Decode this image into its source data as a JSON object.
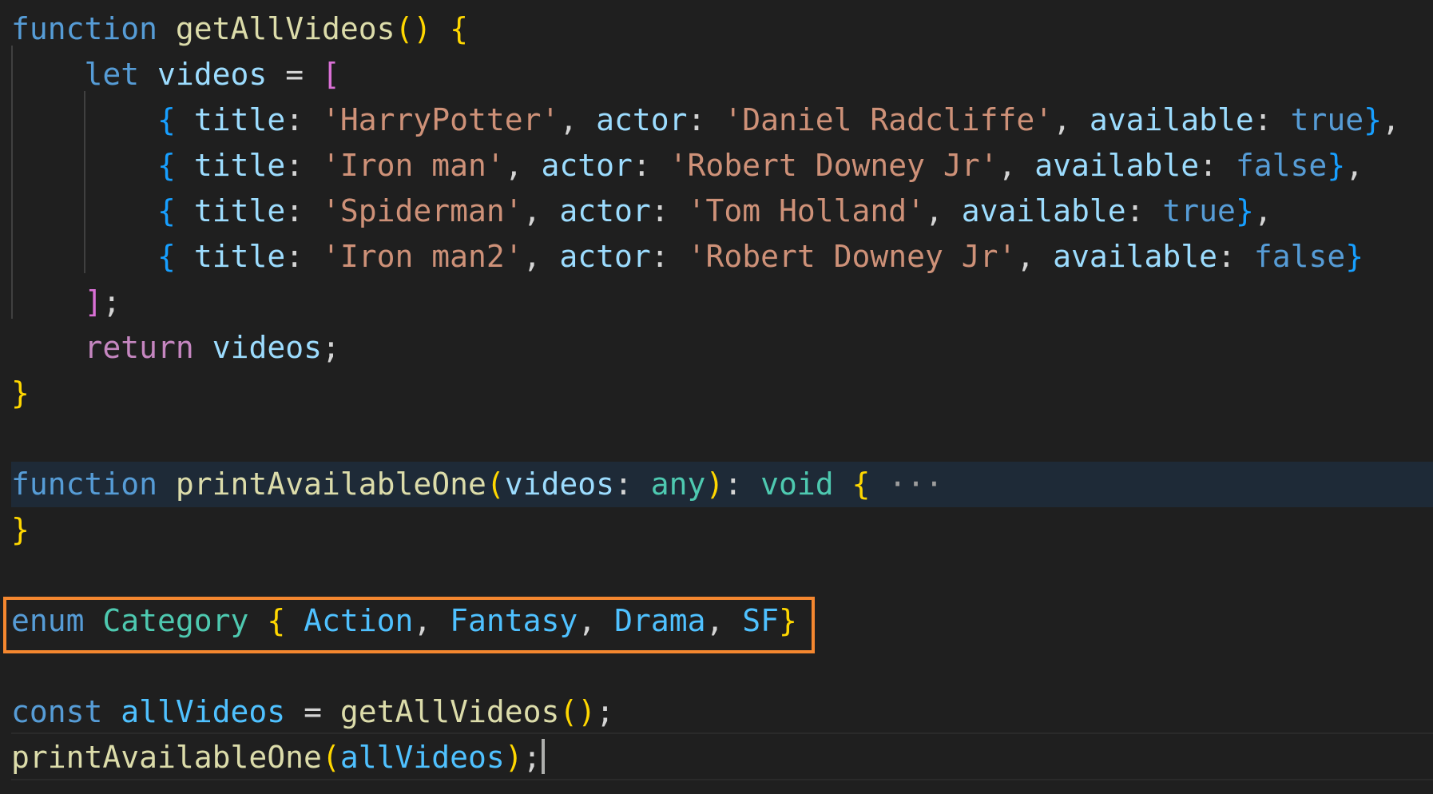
{
  "editor": {
    "lines": [
      [
        {
          "t": "function",
          "c": "kw"
        },
        {
          "t": " ",
          "c": "p"
        },
        {
          "t": "getAllVideos",
          "c": "fn"
        },
        {
          "t": "()",
          "c": "b1"
        },
        {
          "t": " ",
          "c": "p"
        },
        {
          "t": "{",
          "c": "b1"
        }
      ],
      [
        {
          "t": "    ",
          "c": "p"
        },
        {
          "t": "let",
          "c": "kw"
        },
        {
          "t": " ",
          "c": "p"
        },
        {
          "t": "videos",
          "c": "var"
        },
        {
          "t": " = ",
          "c": "p"
        },
        {
          "t": "[",
          "c": "b2"
        }
      ],
      [
        {
          "t": "        ",
          "c": "p"
        },
        {
          "t": "{",
          "c": "b3"
        },
        {
          "t": " ",
          "c": "p"
        },
        {
          "t": "title",
          "c": "var"
        },
        {
          "t": ": ",
          "c": "p"
        },
        {
          "t": "'HarryPotter'",
          "c": "str"
        },
        {
          "t": ", ",
          "c": "p"
        },
        {
          "t": "actor",
          "c": "var"
        },
        {
          "t": ": ",
          "c": "p"
        },
        {
          "t": "'Daniel Radcliffe'",
          "c": "str"
        },
        {
          "t": ", ",
          "c": "p"
        },
        {
          "t": "available",
          "c": "var"
        },
        {
          "t": ": ",
          "c": "p"
        },
        {
          "t": "true",
          "c": "bool"
        },
        {
          "t": "}",
          "c": "b3"
        },
        {
          "t": ",",
          "c": "p"
        }
      ],
      [
        {
          "t": "        ",
          "c": "p"
        },
        {
          "t": "{",
          "c": "b3"
        },
        {
          "t": " ",
          "c": "p"
        },
        {
          "t": "title",
          "c": "var"
        },
        {
          "t": ": ",
          "c": "p"
        },
        {
          "t": "'Iron man'",
          "c": "str"
        },
        {
          "t": ", ",
          "c": "p"
        },
        {
          "t": "actor",
          "c": "var"
        },
        {
          "t": ": ",
          "c": "p"
        },
        {
          "t": "'Robert Downey Jr'",
          "c": "str"
        },
        {
          "t": ", ",
          "c": "p"
        },
        {
          "t": "available",
          "c": "var"
        },
        {
          "t": ": ",
          "c": "p"
        },
        {
          "t": "false",
          "c": "bool"
        },
        {
          "t": "}",
          "c": "b3"
        },
        {
          "t": ",",
          "c": "p"
        }
      ],
      [
        {
          "t": "        ",
          "c": "p"
        },
        {
          "t": "{",
          "c": "b3"
        },
        {
          "t": " ",
          "c": "p"
        },
        {
          "t": "title",
          "c": "var"
        },
        {
          "t": ": ",
          "c": "p"
        },
        {
          "t": "'Spiderman'",
          "c": "str"
        },
        {
          "t": ", ",
          "c": "p"
        },
        {
          "t": "actor",
          "c": "var"
        },
        {
          "t": ": ",
          "c": "p"
        },
        {
          "t": "'Tom Holland'",
          "c": "str"
        },
        {
          "t": ", ",
          "c": "p"
        },
        {
          "t": "available",
          "c": "var"
        },
        {
          "t": ": ",
          "c": "p"
        },
        {
          "t": "true",
          "c": "bool"
        },
        {
          "t": "}",
          "c": "b3"
        },
        {
          "t": ",",
          "c": "p"
        }
      ],
      [
        {
          "t": "        ",
          "c": "p"
        },
        {
          "t": "{",
          "c": "b3"
        },
        {
          "t": " ",
          "c": "p"
        },
        {
          "t": "title",
          "c": "var"
        },
        {
          "t": ": ",
          "c": "p"
        },
        {
          "t": "'Iron man2'",
          "c": "str"
        },
        {
          "t": ", ",
          "c": "p"
        },
        {
          "t": "actor",
          "c": "var"
        },
        {
          "t": ": ",
          "c": "p"
        },
        {
          "t": "'Robert Downey Jr'",
          "c": "str"
        },
        {
          "t": ", ",
          "c": "p"
        },
        {
          "t": "available",
          "c": "var"
        },
        {
          "t": ": ",
          "c": "p"
        },
        {
          "t": "false",
          "c": "bool"
        },
        {
          "t": "}",
          "c": "b3"
        }
      ],
      [
        {
          "t": "    ",
          "c": "p"
        },
        {
          "t": "]",
          "c": "b2"
        },
        {
          "t": ";",
          "c": "p"
        }
      ],
      [
        {
          "t": "    ",
          "c": "p"
        },
        {
          "t": "return",
          "c": "ctl"
        },
        {
          "t": " ",
          "c": "p"
        },
        {
          "t": "videos",
          "c": "var"
        },
        {
          "t": ";",
          "c": "p"
        }
      ],
      [
        {
          "t": "}",
          "c": "b1"
        }
      ],
      [],
      [
        {
          "t": "function",
          "c": "kw"
        },
        {
          "t": " ",
          "c": "p"
        },
        {
          "t": "printAvailableOne",
          "c": "fn"
        },
        {
          "t": "(",
          "c": "b1"
        },
        {
          "t": "videos",
          "c": "var"
        },
        {
          "t": ": ",
          "c": "p"
        },
        {
          "t": "any",
          "c": "typ"
        },
        {
          "t": ")",
          "c": "b1"
        },
        {
          "t": ": ",
          "c": "p"
        },
        {
          "t": "void",
          "c": "typ"
        },
        {
          "t": " ",
          "c": "p"
        },
        {
          "t": "{",
          "c": "b1"
        },
        {
          "t": " ···",
          "c": "ell"
        }
      ],
      [
        {
          "t": "}",
          "c": "b1"
        }
      ],
      [],
      [
        {
          "t": "enum",
          "c": "kw"
        },
        {
          "t": " ",
          "c": "p"
        },
        {
          "t": "Category",
          "c": "typ"
        },
        {
          "t": " ",
          "c": "p"
        },
        {
          "t": "{",
          "c": "b1"
        },
        {
          "t": " ",
          "c": "p"
        },
        {
          "t": "Action",
          "c": "cst"
        },
        {
          "t": ", ",
          "c": "p"
        },
        {
          "t": "Fantasy",
          "c": "cst"
        },
        {
          "t": ", ",
          "c": "p"
        },
        {
          "t": "Drama",
          "c": "cst"
        },
        {
          "t": ", ",
          "c": "p"
        },
        {
          "t": "SF",
          "c": "cst"
        },
        {
          "t": "}",
          "c": "b1"
        }
      ],
      [],
      [
        {
          "t": "const",
          "c": "kw"
        },
        {
          "t": " ",
          "c": "p"
        },
        {
          "t": "allVideos",
          "c": "cst"
        },
        {
          "t": " = ",
          "c": "p"
        },
        {
          "t": "getAllVideos",
          "c": "fn"
        },
        {
          "t": "()",
          "c": "b1"
        },
        {
          "t": ";",
          "c": "p"
        }
      ],
      [
        {
          "t": "printAvailableOne",
          "c": "fn"
        },
        {
          "t": "(",
          "c": "b1"
        },
        {
          "t": "allVideos",
          "c": "cst"
        },
        {
          "t": ")",
          "c": "b1"
        },
        {
          "t": ";",
          "c": "p"
        }
      ]
    ]
  },
  "colors": {
    "background": "#1f1f1f",
    "highlight_box": "#f5872f",
    "keyword": "#569cd6",
    "function": "#dcdcaa",
    "string": "#ce9178",
    "type": "#4ec9b0"
  }
}
